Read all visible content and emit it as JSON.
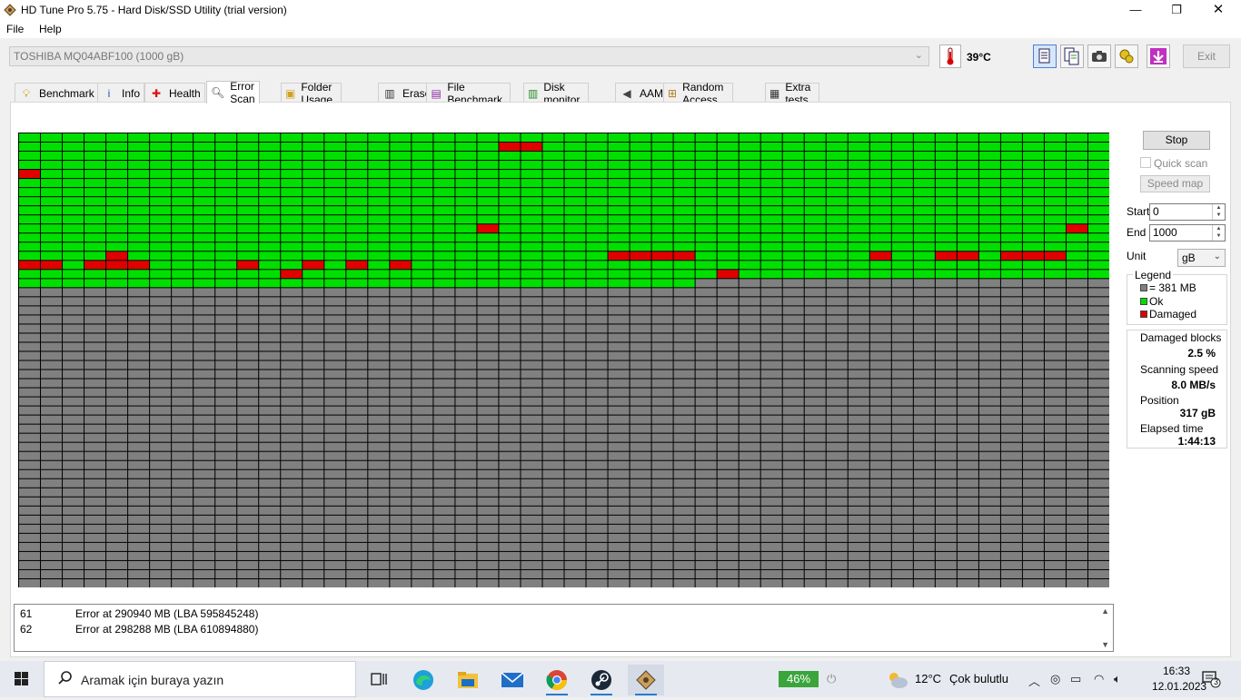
{
  "window": {
    "title": "HD Tune Pro 5.75 - Hard Disk/SSD Utility (trial version)",
    "min_icon": "minimize-icon",
    "max_icon": "maximize-icon",
    "close_icon": "close-icon"
  },
  "menu": {
    "file": "File",
    "help": "Help"
  },
  "toolbar": {
    "drive": "TOSHIBA MQ04ABF100 (1000 gB)",
    "temperature": "39°C",
    "exit_label": "Exit"
  },
  "tabs": [
    {
      "label": "Benchmark",
      "icon": "benchmark-icon"
    },
    {
      "label": "Info",
      "icon": "info-icon"
    },
    {
      "label": "Health",
      "icon": "health-icon"
    },
    {
      "label": "Error Scan",
      "icon": "error-scan-icon",
      "active": true
    },
    {
      "label": "Folder Usage",
      "icon": "folder-usage-icon"
    },
    {
      "label": "Erase",
      "icon": "erase-icon"
    },
    {
      "label": "File Benchmark",
      "icon": "file-benchmark-icon"
    },
    {
      "label": "Disk monitor",
      "icon": "disk-monitor-icon"
    },
    {
      "label": "AAM",
      "icon": "aam-icon"
    },
    {
      "label": "Random Access",
      "icon": "random-access-icon"
    },
    {
      "label": "Extra tests",
      "icon": "extra-tests-icon"
    }
  ],
  "scan": {
    "columns": 50,
    "rows": 50,
    "scanned_blocks": 831,
    "damaged_blocks": [
      [
        1,
        22
      ],
      [
        1,
        23
      ],
      [
        4,
        0
      ],
      [
        10,
        21
      ],
      [
        10,
        48
      ],
      [
        13,
        4
      ],
      [
        13,
        27
      ],
      [
        13,
        28
      ],
      [
        13,
        29
      ],
      [
        13,
        30
      ],
      [
        13,
        39
      ],
      [
        13,
        42
      ],
      [
        13,
        43
      ],
      [
        13,
        45
      ],
      [
        13,
        46
      ],
      [
        13,
        47
      ],
      [
        14,
        0
      ],
      [
        14,
        1
      ],
      [
        14,
        3
      ],
      [
        14,
        4
      ],
      [
        14,
        5
      ],
      [
        14,
        10
      ],
      [
        14,
        13
      ],
      [
        14,
        15
      ],
      [
        14,
        17
      ],
      [
        15,
        12
      ],
      [
        15,
        32
      ]
    ],
    "colors": {
      "unscanned": "#808080",
      "ok": "#00e000",
      "damaged": "#e00000",
      "grid": "#000000"
    }
  },
  "controls": {
    "stop_label": "Stop",
    "quick_scan_label": "Quick scan",
    "quick_scan_checked": false,
    "speed_map_label": "Speed map",
    "start_label": "Start",
    "start_value": "0",
    "end_label": "End",
    "end_value": "1000",
    "unit_label": "Unit",
    "unit_value": "gB"
  },
  "legend": {
    "title": "Legend",
    "block_size": "= 381 MB",
    "ok": "Ok",
    "damaged": "Damaged"
  },
  "stats": {
    "damaged_label": "Damaged blocks",
    "damaged_value": "2.5 %",
    "speed_label": "Scanning speed",
    "speed_value": "8.0 MB/s",
    "position_label": "Position",
    "position_value": "317 gB",
    "elapsed_label": "Elapsed time",
    "elapsed_value": "1:44:13"
  },
  "log": [
    {
      "num": "61",
      "message": "Error at 290940 MB (LBA 595845248)"
    },
    {
      "num": "62",
      "message": "Error at 298288 MB (LBA 610894880)"
    }
  ],
  "taskbar": {
    "search_placeholder": "Aramak için buraya yazın",
    "battery": "46%",
    "weather_temp": "12°C",
    "weather_text": "Çok bulutlu",
    "time": "16:33",
    "date": "12.01.2023",
    "notification_count": "3"
  }
}
